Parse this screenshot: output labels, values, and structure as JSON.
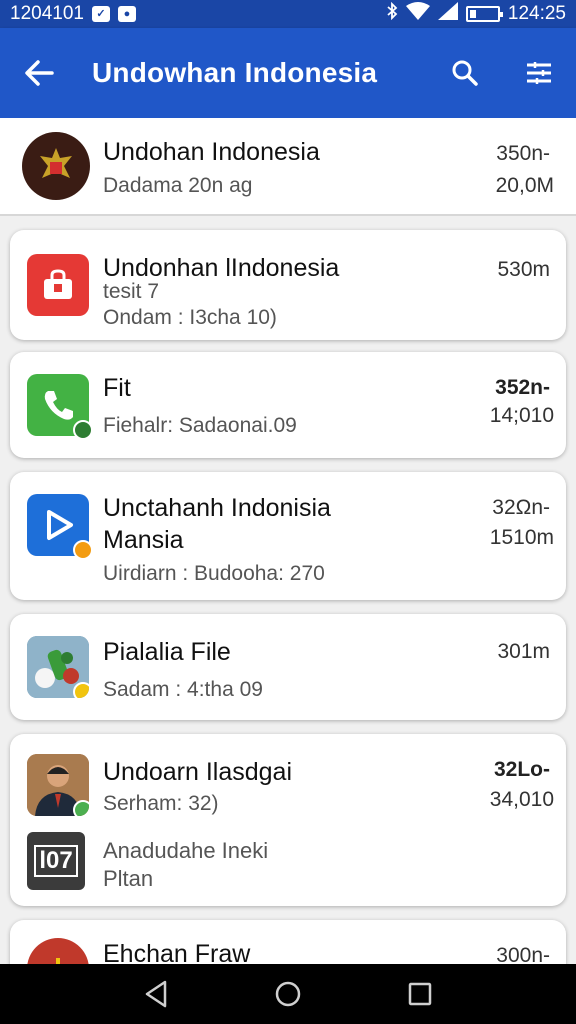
{
  "status_bar": {
    "time_left": "1204101",
    "time_right": "124:25"
  },
  "header": {
    "title": "Undowhan Indonesia"
  },
  "apps": [
    {
      "name": "Undohan Indonesia",
      "line1": "Dadama 20n ag",
      "size": "350n-",
      "count": "20,0M",
      "icon": "garuda-emblem-icon"
    },
    {
      "name": "Undonhan lIndonesia",
      "line1": "tesit 7",
      "line2": "Ondam : I3cha 10)",
      "size": "530m",
      "icon": "shopping-bag-icon",
      "icon_color": "#e53935"
    },
    {
      "name": "Fit",
      "line1": "Fiehalr: Sadaonai.09",
      "size": "352n-",
      "count": "14;010",
      "icon": "phone-icon",
      "icon_color": "#43b244"
    },
    {
      "name": "Unctahanh Indonisia",
      "name2": "Mansia",
      "line1": "Uirdiarn : Budooha: 270",
      "size": "32Ωn-",
      "count": "1510m",
      "icon": "play-video-icon",
      "icon_color": "#1e6fd9"
    },
    {
      "name": "Pialalia File",
      "line1": "Sadam : 4:tha 09",
      "size": "301m",
      "icon": "vegetables-photo-icon"
    },
    {
      "name": "Undoarn Ilasdgai",
      "line1": "Serham: 32)",
      "size": "32Lo-",
      "count": "34,010",
      "icon": "person-photo-icon",
      "sub_name": "Anadudahe Ineki",
      "sub_line": "Pltan",
      "sub_icon": "l07-logo-icon",
      "sub_icon_text": "l07"
    },
    {
      "name": "Ehchan Fraw",
      "size": "300n-",
      "icon": "red-logo-icon"
    }
  ]
}
